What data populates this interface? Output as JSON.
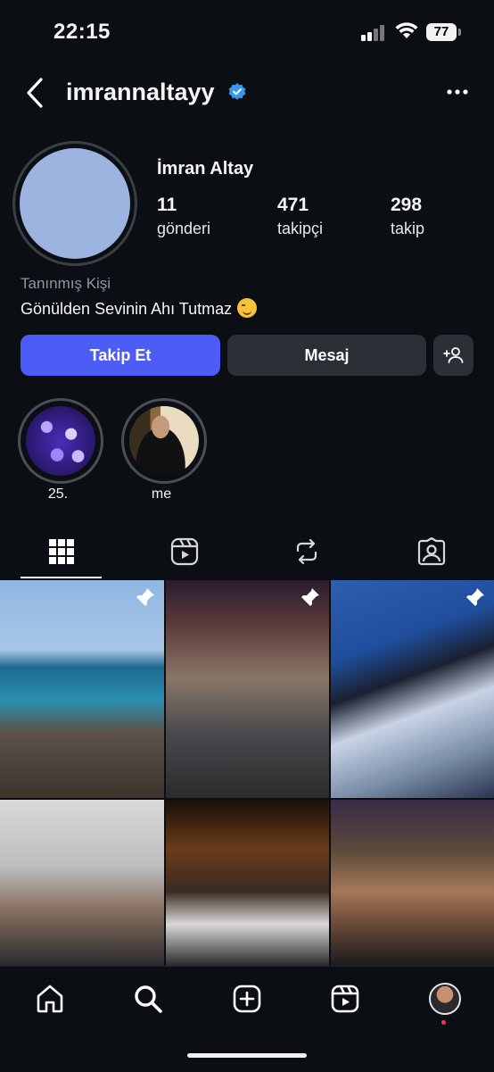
{
  "status_bar": {
    "time": "22:15",
    "battery": "77"
  },
  "header": {
    "username": "imrannaltayy",
    "verified": true
  },
  "profile": {
    "full_name": "İmran Altay",
    "stats": [
      {
        "value": "11",
        "label": "gönderi"
      },
      {
        "value": "471",
        "label": "takipçi"
      },
      {
        "value": "298",
        "label": "takip"
      }
    ],
    "category": "Tanınmış Kişi",
    "bio": "Gönülden Sevinin Ahı Tutmaz",
    "bio_emoji": "winking-face"
  },
  "actions": {
    "follow_label": "Takip Et",
    "message_label": "Mesaj"
  },
  "highlights": [
    {
      "label": "25."
    },
    {
      "label": "me"
    }
  ],
  "tabs": [
    "grid",
    "reels",
    "reposts",
    "tagged"
  ],
  "colors": {
    "accent": "#4d5cf5",
    "background": "#0b0f14",
    "verified": "#3897f0",
    "avatar": "#9db4e0"
  },
  "posts": [
    {
      "pinned": true,
      "scene": "seaside"
    },
    {
      "pinned": true,
      "scene": "street-night"
    },
    {
      "pinned": true,
      "scene": "blue-car"
    },
    {
      "pinned": false,
      "scene": "mirror-selfie"
    },
    {
      "pinned": false,
      "scene": "restaurant-night"
    },
    {
      "pinned": false,
      "scene": "selfie-duo"
    }
  ]
}
